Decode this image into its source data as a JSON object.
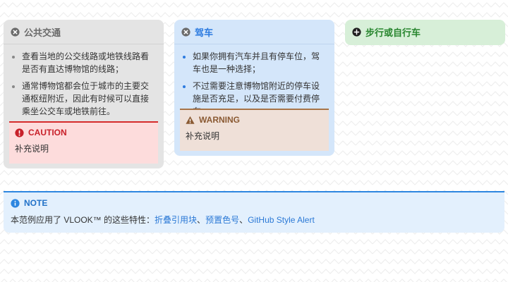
{
  "transit": {
    "title": "公共交通",
    "icon": "x-circle-icon",
    "items": [
      "查看当地的公交线路或地铁线路看是否有直达博物馆的线路；",
      "通常博物馆都会位于城市的主要交通枢纽附近，因此有时候可以直接乘坐公交车或地铁前往。"
    ],
    "caution": {
      "label": "CAUTION",
      "icon": "alert-circle-icon",
      "text": "补充说明",
      "color": "#d62b2b"
    }
  },
  "drive": {
    "title": "驾车",
    "icon": "x-circle-icon",
    "items": [
      "如果你拥有汽车并且有停车位，驾车也是一种选择；",
      "不过需要注意博物馆附近的停车设施是否充足，以及是否需要付费停车。"
    ],
    "warning": {
      "label": "WARNING",
      "icon": "warning-triangle-icon",
      "text": "补充说明",
      "color": "#a77447"
    }
  },
  "walk": {
    "title": "步行或自行车",
    "icon": "plus-circle-icon"
  },
  "note": {
    "label": "NOTE",
    "icon": "info-circle-icon",
    "prefix": "本范例应用了 VLOOK™ 的这些特性：",
    "links": [
      "折叠引用块",
      "预置色号",
      "GitHub Style Alert"
    ],
    "sep": "、"
  }
}
